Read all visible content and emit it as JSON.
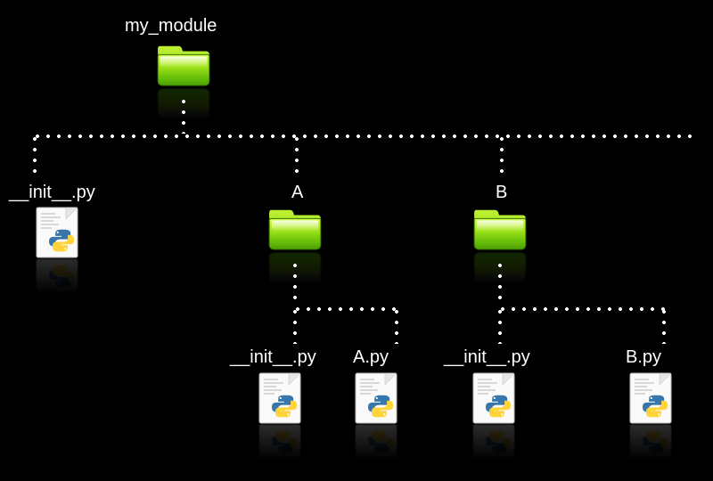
{
  "root": {
    "label": "my_module",
    "children": {
      "init": "__init__.py",
      "A": {
        "label": "A",
        "children": {
          "init": "__init__.py",
          "file": "A.py"
        }
      },
      "B": {
        "label": "B",
        "children": {
          "init": "__init__.py",
          "file": "B.py"
        }
      }
    }
  }
}
